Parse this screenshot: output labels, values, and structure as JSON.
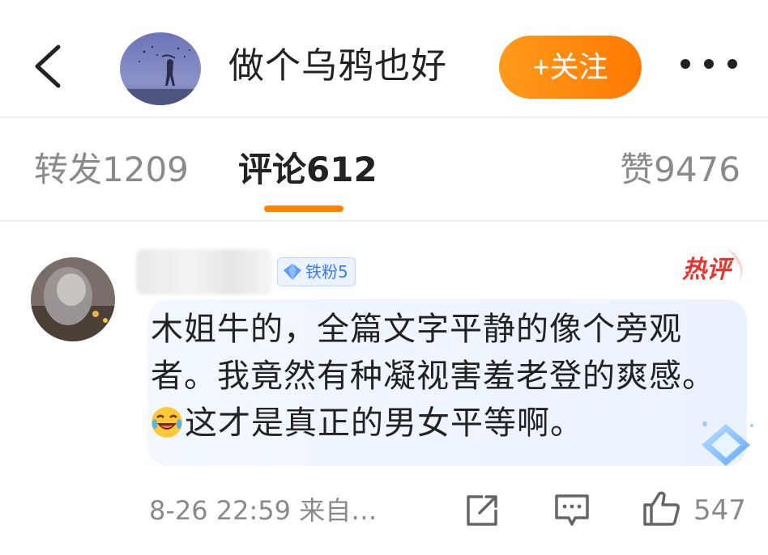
{
  "header": {
    "title": "做个乌鸦也好",
    "follow_label": "+关注",
    "icons": [
      "back-icon",
      "more-icon"
    ]
  },
  "tabs": {
    "repost": "转发1209",
    "comment": "评论612",
    "like": "赞9476"
  },
  "comment": {
    "badge": "铁粉5",
    "hot_label": "热评",
    "text_lines": [
      "木姐牛的，全篇文字平静的像个旁观",
      "者。我竟然有种凝视害羞老登的爽感。",
      "这才是真正的男女平等啊。"
    ],
    "meta": "8-26 22:59 来自…",
    "like_count": "547",
    "icons": [
      "share-icon",
      "comment-icon",
      "like-icon",
      "laughing-emoji"
    ]
  },
  "colors": {
    "accent": "#ff8200",
    "hot": "#e8332e",
    "badge": "#3a7df0",
    "bubble": "#eef5ff"
  }
}
